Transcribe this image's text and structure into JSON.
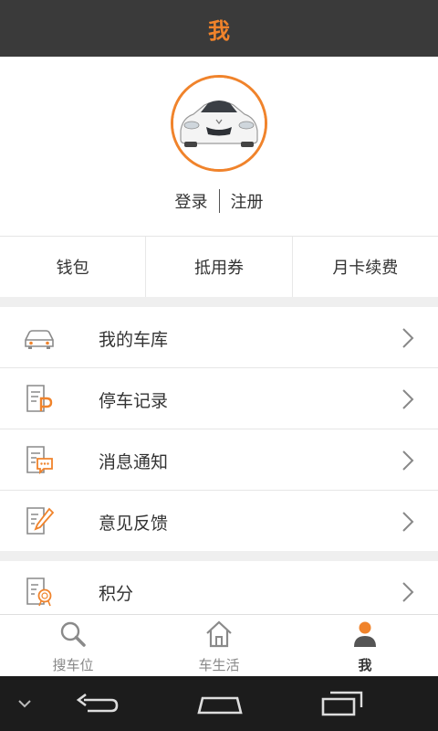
{
  "header": {
    "title": "我"
  },
  "profile": {
    "avatar_icon": "car-avatar",
    "login_label": "登录",
    "register_label": "注册"
  },
  "quick_actions": [
    {
      "label": "钱包"
    },
    {
      "label": "抵用券"
    },
    {
      "label": "月卡续费"
    }
  ],
  "menu": [
    {
      "label": "我的车库",
      "icon": "car-icon"
    },
    {
      "label": "停车记录",
      "icon": "parking-record-icon"
    },
    {
      "label": "消息通知",
      "icon": "message-icon"
    },
    {
      "label": "意见反馈",
      "icon": "feedback-icon"
    },
    {
      "label": "积分",
      "icon": "points-icon"
    }
  ],
  "tabbar": {
    "tabs": [
      {
        "label": "搜车位",
        "icon": "search-icon"
      },
      {
        "label": "车生活",
        "icon": "home-icon"
      },
      {
        "label": "我",
        "icon": "person-icon",
        "active": true
      }
    ]
  },
  "colors": {
    "accent": "#f0832b",
    "header_bg": "#3a3a3a"
  }
}
